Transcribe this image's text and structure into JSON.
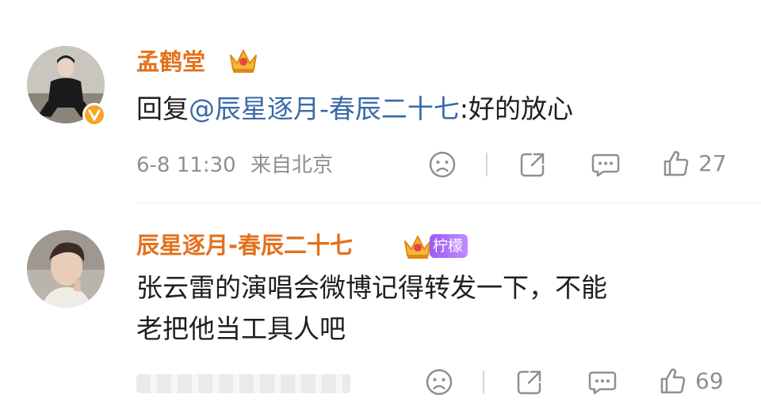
{
  "comments": [
    {
      "username": "孟鹤堂",
      "reply_prefix": "回复",
      "mention": "@辰星逐月-春辰二十七",
      "body": ":好的放心",
      "date": "6-8 11:30",
      "location": "来自北京",
      "like_count": "27",
      "avatar_icon": "avatar-photo-man-black-suit",
      "verified_icon": "verified-v-badge",
      "crown_icon": "vip-crown-icon"
    },
    {
      "username": "辰星逐月-春辰二十七",
      "badge_label": "柠檬",
      "body_line1": "张云雷的演唱会微博记得转发一下，不能",
      "body_line2": "老把他当工具人吧",
      "like_count": "69",
      "avatar_icon": "avatar-photo-young-man",
      "crown_icon": "vip-crown-icon"
    }
  ],
  "colors": {
    "username": "#e2711d",
    "mention": "#3a6aa8",
    "meta": "#8f8f8f",
    "body": "#1f1f1f"
  }
}
